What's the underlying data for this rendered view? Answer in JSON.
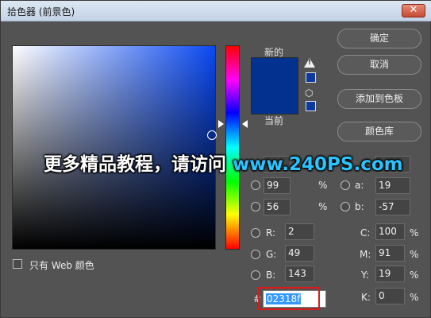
{
  "window": {
    "title": "拾色器 (前景色)",
    "close_symbol": "✕"
  },
  "preview": {
    "new_label": "新的",
    "current_label": "当前",
    "color": "#02318f"
  },
  "buttons": {
    "ok": "确定",
    "cancel": "取消",
    "add_swatch": "添加到色板",
    "color_lib": "颜色库"
  },
  "hsb": {
    "s": {
      "label": "S:",
      "value": "99",
      "unit": "%"
    },
    "b": {
      "label": "B:",
      "value": "56",
      "unit": "%"
    }
  },
  "lab": {
    "a": {
      "label": "a:",
      "value": "19"
    },
    "b": {
      "label": "b:",
      "value": "-57"
    }
  },
  "rgb": {
    "r": {
      "label": "R:",
      "value": "2"
    },
    "g": {
      "label": "G:",
      "value": "49"
    },
    "b": {
      "label": "B:",
      "value": "143"
    }
  },
  "cmyk": {
    "c": {
      "label": "C:",
      "value": "100",
      "unit": "%"
    },
    "m": {
      "label": "M:",
      "value": "91",
      "unit": "%"
    },
    "y": {
      "label": "Y:",
      "value": "19",
      "unit": "%"
    },
    "k": {
      "label": "K:",
      "value": "0",
      "unit": "%"
    }
  },
  "hex": {
    "label": "#",
    "value": "02318f"
  },
  "web_only": {
    "label": "只有 Web 颜色"
  },
  "watermark": {
    "text": "更多精品教程，请访问 ",
    "url": "www.240PS.com"
  }
}
